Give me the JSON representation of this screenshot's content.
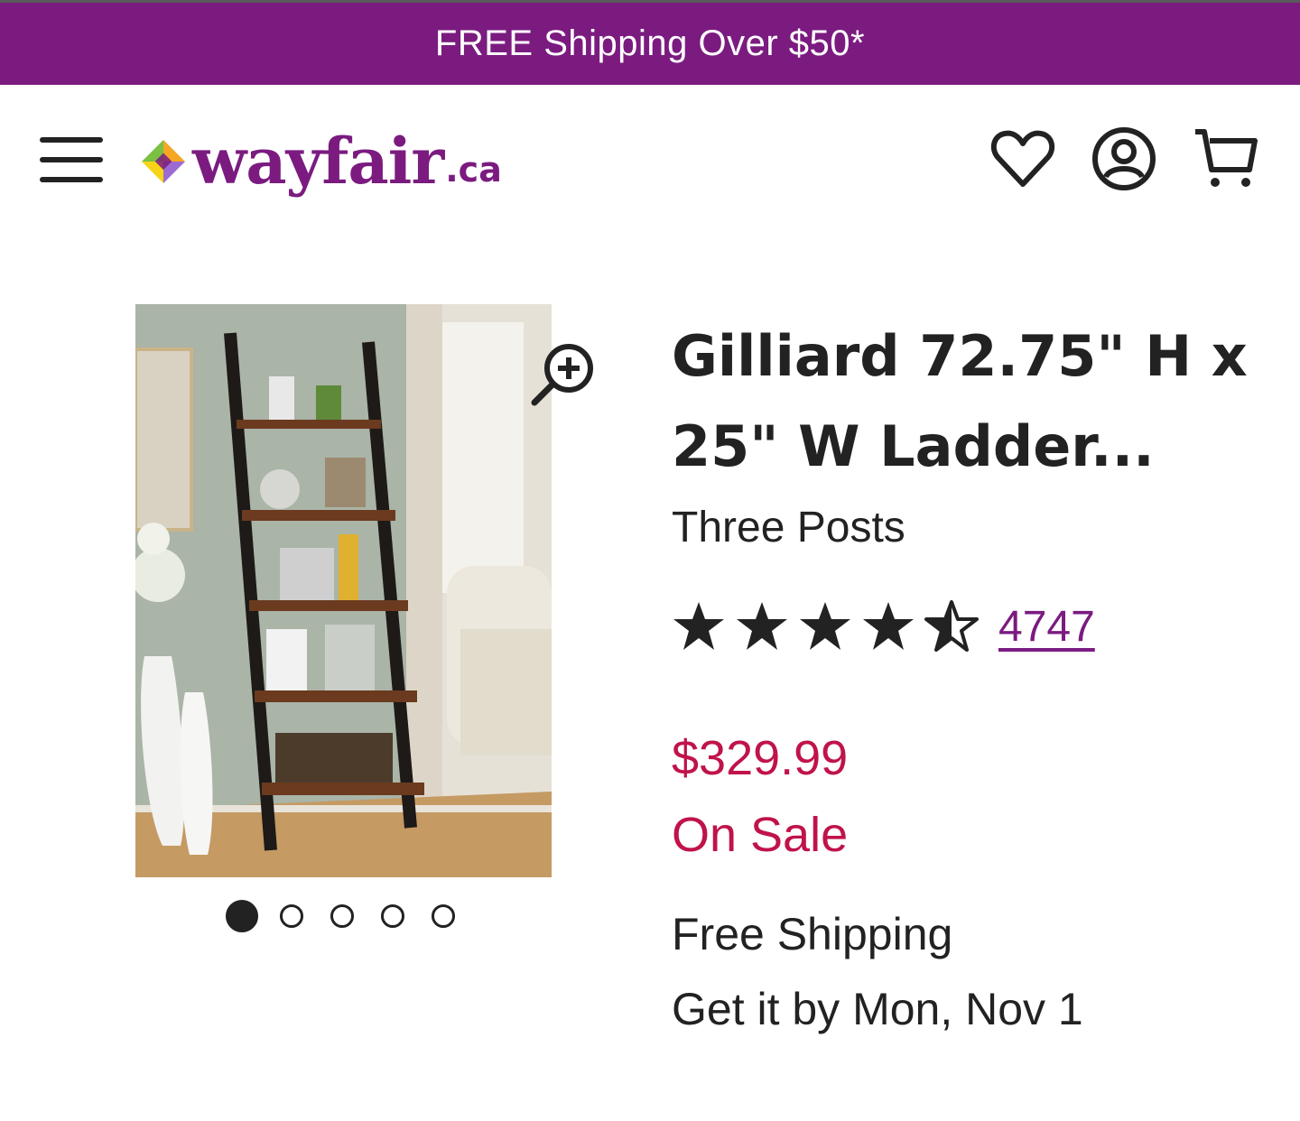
{
  "promo": {
    "text": "FREE Shipping Over $50*"
  },
  "header": {
    "logo_text": "wayfair",
    "logo_tld": ".ca",
    "brand_color": "#7b1b80",
    "icons": [
      "menu-icon",
      "heart-icon",
      "account-icon",
      "cart-icon"
    ]
  },
  "gallery": {
    "image_count": 5,
    "active_index": 0
  },
  "product": {
    "title_line1": "Gilliard 72.75\" H x",
    "title_line2": "25\" W Ladder...",
    "brand": "Three Posts",
    "rating": 4.5,
    "rating_max": 5,
    "review_count": "4747",
    "price": "$329.99",
    "sale_label": "On Sale",
    "sale_color": "#c0134a",
    "shipping": "Free Shipping",
    "delivery": "Get it by Mon, Nov 1"
  }
}
